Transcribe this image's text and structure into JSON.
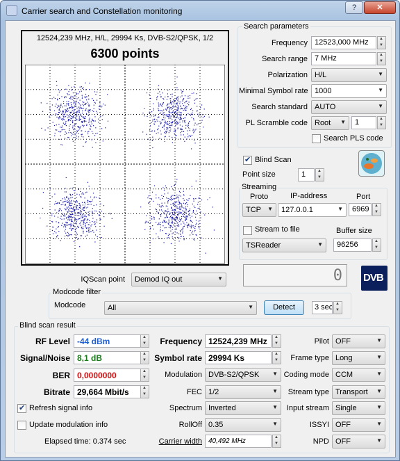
{
  "window": {
    "title": "Carrier search and Constellation monitoring",
    "help_label": "?",
    "close_label": "✕"
  },
  "constellation": {
    "info": "12524,239 MHz, H/L, 29994 Ks, DVB-S2/QPSK, 1/2",
    "points_label": "6300 points",
    "chart_data": {
      "type": "scatter",
      "title": "6300 points",
      "xlim": [
        -1,
        1
      ],
      "ylim": [
        -1,
        1
      ],
      "grid": true,
      "clusters": [
        [
          -0.5,
          0.5
        ],
        [
          0.5,
          0.5
        ],
        [
          -0.5,
          -0.5
        ],
        [
          0.5,
          -0.5
        ]
      ],
      "point_color": "#1a1aa8"
    }
  },
  "search": {
    "title": "Search parameters",
    "frequency_label": "Frequency",
    "frequency_value": "12523,000 MHz",
    "range_label": "Search range",
    "range_value": "7 MHz",
    "polarization_label": "Polarization",
    "polarization_value": "H/L",
    "min_sr_label": "Minimal Symbol rate",
    "min_sr_value": "1000",
    "standard_label": "Search standard",
    "standard_value": "AUTO",
    "pls_label": "PL Scramble code",
    "pls_mode": "Root",
    "pls_value": "1",
    "search_pls_label": "Search PLS code"
  },
  "blind": {
    "blind_scan_label": "Blind Scan",
    "point_size_label": "Point size",
    "point_size_value": "1"
  },
  "streaming": {
    "title": "Streaming",
    "proto_label": "Proto",
    "ip_label": "IP-address",
    "port_label": "Port",
    "proto_value": "TCP",
    "ip_value": "127.0.0.1",
    "port_value": "6969",
    "stream_file_label": "Stream to file",
    "buffer_label": "Buffer size",
    "reader_value": "TSReader",
    "buffer_value": "96256"
  },
  "counter": {
    "value": "0"
  },
  "logo_text": "DVB",
  "iq": {
    "label": "IQScan point",
    "value": "Demod IQ out"
  },
  "modcode": {
    "title": "Modcode filter",
    "label": "Modcode",
    "value": "All",
    "detect_label": "Detect",
    "timeout_value": "3 sec"
  },
  "result": {
    "title": "Blind scan result",
    "rf_label": "RF Level",
    "rf_value": "-44 dBm",
    "snr_label": "Signal/Noise",
    "snr_value": "8,1 dB",
    "ber_label": "BER",
    "ber_value": "0,0000000",
    "bitrate_label": "Bitrate",
    "bitrate_value": "29,664 Mbit/s",
    "refresh_label": "Refresh signal info",
    "update_label": "Update modulation info",
    "elapsed": "Elapsed time: 0.374 sec",
    "freq_label": "Frequency",
    "freq_value": "12524,239 MHz",
    "sr_label": "Symbol rate",
    "sr_value": "29994 Ks",
    "mod_label": "Modulation",
    "mod_value": "DVB-S2/QPSK",
    "fec_label": "FEC",
    "fec_value": "1/2",
    "spectrum_label": "Spectrum",
    "spectrum_value": "Inverted",
    "rolloff_label": "RollOff",
    "rolloff_value": "0.35",
    "cw_label": "Carrier width",
    "cw_value": "40,492 MHz",
    "pilot_label": "Pilot",
    "pilot_value": "OFF",
    "frame_label": "Frame type",
    "frame_value": "Long",
    "coding_label": "Coding mode",
    "coding_value": "CCM",
    "stream_type_label": "Stream type",
    "stream_type_value": "Transport",
    "input_label": "Input stream",
    "input_value": "Single",
    "issyi_label": "ISSYI",
    "issyi_value": "OFF",
    "npd_label": "NPD",
    "npd_value": "OFF"
  },
  "colors": {
    "rf": "#1f5fd0",
    "snr": "#1b7a1b",
    "ber": "#d01010",
    "points": "#1a1aa8"
  }
}
